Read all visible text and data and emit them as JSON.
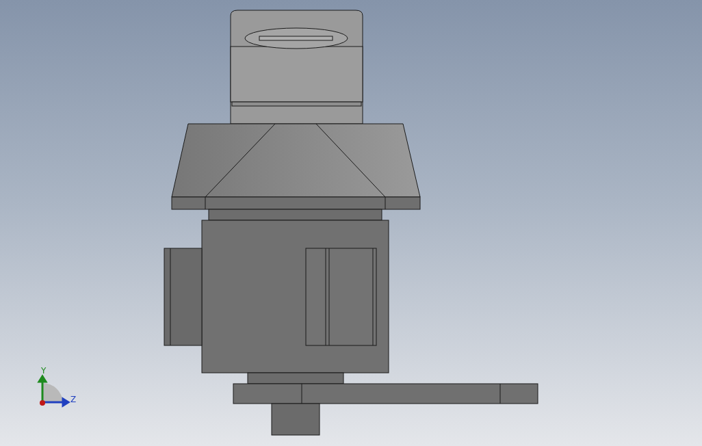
{
  "viewport": {
    "axes": [
      {
        "kind": "y",
        "label": "Y"
      },
      {
        "kind": "z",
        "label": "Z"
      }
    ]
  }
}
